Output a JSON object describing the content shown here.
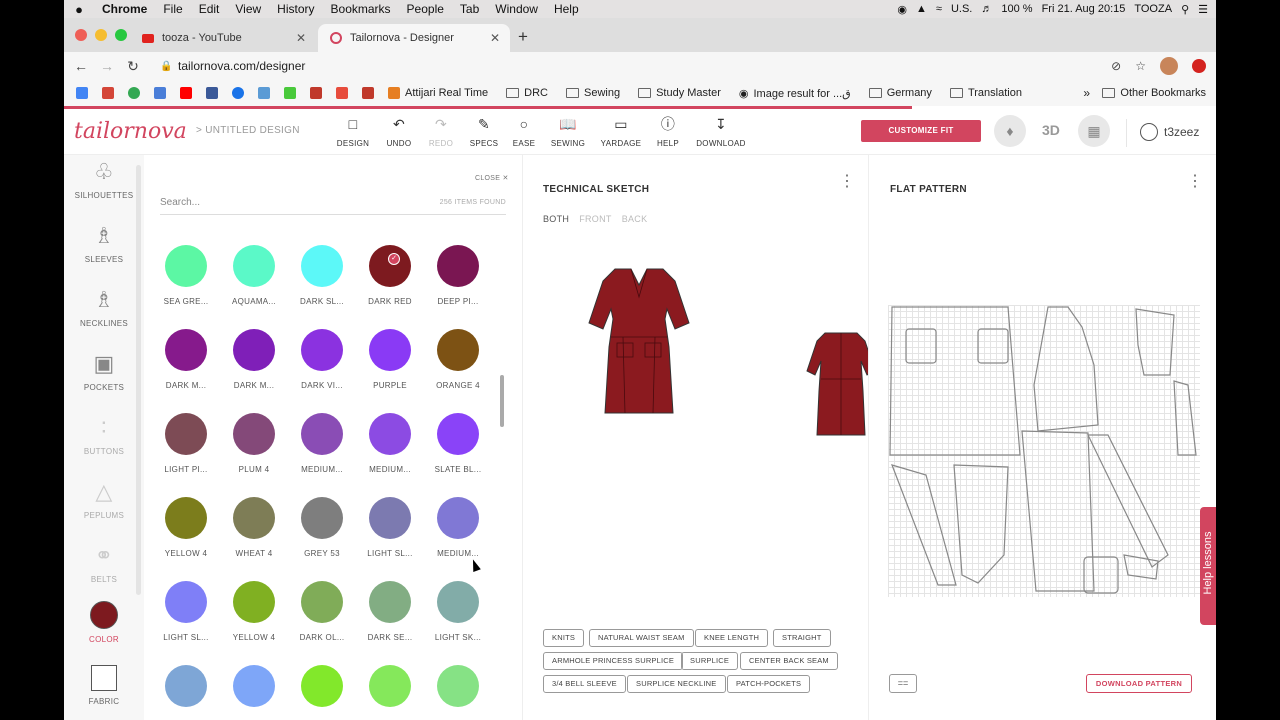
{
  "menubar": {
    "apple": "",
    "items": [
      "Chrome",
      "File",
      "Edit",
      "View",
      "History",
      "Bookmarks",
      "People",
      "Tab",
      "Window",
      "Help"
    ],
    "locale": "U.S.",
    "battery": "100 %",
    "datetime": "Fri 21. Aug  20:15",
    "user": "TOOZA"
  },
  "tabs": [
    {
      "label": "tooza - YouTube"
    },
    {
      "label": "Tailornova - Designer"
    }
  ],
  "address": {
    "url": "tailornova.com/designer"
  },
  "bookmarks": {
    "items": [
      "Attijari Real Time",
      "DRC",
      "Sewing",
      "Study Master",
      "Image result for ...ق",
      "Germany",
      "Translation"
    ],
    "other": "Other Bookmarks",
    "more": "»"
  },
  "app": {
    "logo": "tailornova",
    "breadcrumb": "> UNTITLED DESIGN",
    "tools": [
      "DESIGN",
      "UNDO",
      "REDO",
      "SPECS",
      "EASE",
      "SEWING",
      "YARDAGE",
      "HELP",
      "DOWNLOAD"
    ],
    "customize": "CUSTOMIZE FIT",
    "view3d": "3D",
    "username": "t3zeez"
  },
  "nav": [
    {
      "label": "SILHOUETTES",
      "icon": "dress-icon"
    },
    {
      "label": "SLEEVES",
      "icon": "sleeves-icon"
    },
    {
      "label": "NECKLINES",
      "icon": "neckline-icon"
    },
    {
      "label": "POCKETS",
      "icon": "pocket-icon"
    },
    {
      "label": "BUTTONS",
      "icon": "buttons-icon"
    },
    {
      "label": "PEPLUMS",
      "icon": "peplum-icon"
    },
    {
      "label": "BELTS",
      "icon": "belt-icon"
    },
    {
      "label": "COLOR",
      "icon": "color-swatch"
    },
    {
      "label": "FABRIC",
      "icon": "fabric-swatch"
    }
  ],
  "panel": {
    "close": "CLOSE",
    "search_placeholder": "Search...",
    "found": "256 ITEMS FOUND",
    "swatches": [
      {
        "label": "SEA GRE...",
        "color": "#5cf7a4"
      },
      {
        "label": "AQUAMA...",
        "color": "#5bf9c8"
      },
      {
        "label": "DARK SL...",
        "color": "#5cf8f8"
      },
      {
        "label": "DARK RED",
        "color": "#7d1a1f",
        "selected": true
      },
      {
        "label": "DEEP PI...",
        "color": "#7a1652"
      },
      {
        "label": "DARK M...",
        "color": "#861a8c"
      },
      {
        "label": "DARK M...",
        "color": "#7f1fb8"
      },
      {
        "label": "DARK VI...",
        "color": "#8b32e0"
      },
      {
        "label": "PURPLE",
        "color": "#8a3af5"
      },
      {
        "label": "ORANGE 4",
        "color": "#7d5214"
      },
      {
        "label": "LIGHT PI...",
        "color": "#7d4b55"
      },
      {
        "label": "PLUM 4",
        "color": "#844979"
      },
      {
        "label": "MEDIUM...",
        "color": "#8a4db5"
      },
      {
        "label": "MEDIUM...",
        "color": "#8c4be3"
      },
      {
        "label": "SLATE BL...",
        "color": "#8a43f8"
      },
      {
        "label": "YELLOW 4",
        "color": "#7c7d1c"
      },
      {
        "label": "WHEAT 4",
        "color": "#7e7d56"
      },
      {
        "label": "GREY 53",
        "color": "#7e7e7e"
      },
      {
        "label": "LIGHT SL...",
        "color": "#7c7ab0"
      },
      {
        "label": "MEDIUM...",
        "color": "#8078d5"
      },
      {
        "label": "LIGHT SL...",
        "color": "#7f7ff7"
      },
      {
        "label": "YELLOW 4",
        "color": "#80b022"
      },
      {
        "label": "DARK OL...",
        "color": "#80ac58"
      },
      {
        "label": "DARK SE...",
        "color": "#82ad83"
      },
      {
        "label": "LIGHT SK...",
        "color": "#82aca8"
      },
      {
        "label": "",
        "color": "#7ea6d6"
      },
      {
        "label": "",
        "color": "#7ea6f8"
      },
      {
        "label": "",
        "color": "#82e82b"
      },
      {
        "label": "",
        "color": "#85e85b"
      },
      {
        "label": "",
        "color": "#86e285"
      }
    ]
  },
  "sketch": {
    "title": "TECHNICAL SKETCH",
    "views": [
      "BOTH",
      "FRONT",
      "BACK"
    ],
    "garment_color": "#8b1a1f",
    "tags": [
      "KNITS",
      "NATURAL WAIST SEAM",
      "KNEE LENGTH",
      "STRAIGHT",
      "ARMHOLE PRINCESS SURPLICE",
      "SURPLICE",
      "CENTER BACK SEAM",
      "3/4 BELL SLEEVE",
      "SURPLICE NECKLINE",
      "PATCH-POCKETS"
    ]
  },
  "flat": {
    "title": "FLAT PATTERN",
    "eq": "==",
    "download": "DOWNLOAD PATTERN"
  },
  "help": "Help lessons"
}
